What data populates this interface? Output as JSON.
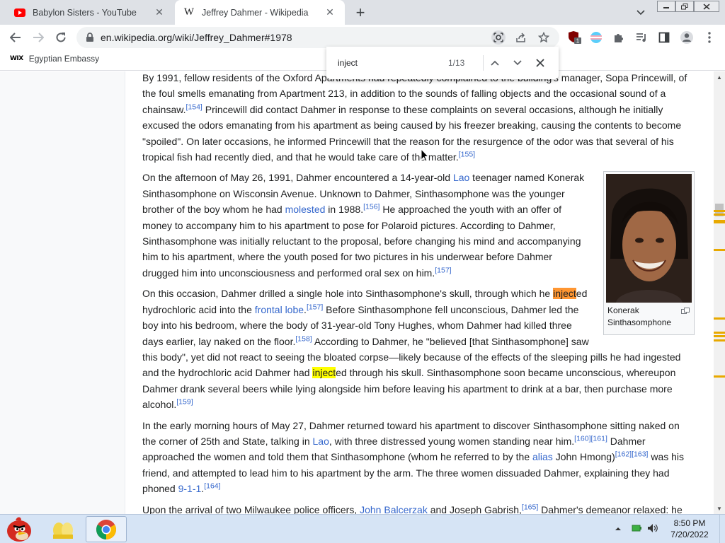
{
  "browser": {
    "tabs": [
      {
        "title": "Babylon Sisters - YouTube",
        "favicon": "youtube-icon",
        "active": false
      },
      {
        "title": "Jeffrey Dahmer - Wikipedia",
        "favicon": "wikipedia-icon",
        "active": true
      }
    ],
    "address": "en.wikipedia.org/wiki/Jeffrey_Dahmer#1978",
    "extension_badge": "1",
    "bookmarks": [
      {
        "label": "Egyptian Embassy",
        "icon_text": "WIX"
      }
    ]
  },
  "find": {
    "query": "inject",
    "count": "1/13"
  },
  "article": {
    "p1": {
      "a": "By 1991, fellow residents of the Oxford Apartments had repeatedly complained to the building's manager, Sopa Princewill, of the foul smells emanating from Apartment 213, in addition to the sounds of falling objects and the occasional sound of a chainsaw.",
      "ref1": "[154]",
      "b": " Princewill did contact Dahmer in response to these complaints on several occasions, although he initially excused the odors emanating from his apartment as being caused by his freezer breaking, causing the contents to become \"spoiled\". On later occasions, he informed Princewill that the reason for the resurgence of the odor was that several of his tropical fish had recently died, and that he would take care of the matter.",
      "ref2": "[155]"
    },
    "p2": {
      "a": "On the afternoon of May 26, 1991, Dahmer encountered a 14-year-old ",
      "link1": "Lao",
      "b": " teenager named Konerak Sinthasomphone on Wisconsin Avenue. Unknown to Dahmer, Sinthasomphone was the younger brother of the boy whom he had ",
      "link2": "molested",
      "c": " in 1988.",
      "ref1": "[156]",
      "d": " He approached the youth with an offer of money to accompany him to his apartment to pose for Polaroid pictures. According to Dahmer, Sinthasomphone was initially reluctant to the proposal, before changing his mind and accompanying him to his apartment, where the youth posed for two pictures in his underwear before Dahmer drugged him into unconsciousness and performed oral sex on him.",
      "ref2": "[157]"
    },
    "p3": {
      "a": "On this occasion, Dahmer drilled a single hole into Sinthasomphone's skull, through which he ",
      "hl1": "inject",
      "b": "ed hydrochloric acid into the ",
      "link1": "frontal lobe",
      "c": ".",
      "ref1": "[157]",
      "d": " Before Sinthasomphone fell unconscious, Dahmer led the boy into his bedroom, where the body of 31-year-old Tony Hughes, whom Dahmer had killed three days earlier, lay naked on the floor.",
      "ref2": "[158]",
      "e": " According to Dahmer, he \"believed [that Sinthasomphone] saw this body\", yet did not react to seeing the bloated corpse—likely because of the effects of the sleeping pills he had ingested and the hydrochloric acid Dahmer had ",
      "hl2": "inject",
      "f": "ed through his skull. Sinthasomphone soon became unconscious, whereupon Dahmer drank several beers while lying alongside him before leaving his apartment to drink at a bar, then purchase more alcohol.",
      "ref3": "[159]"
    },
    "p4": {
      "a": "In the early morning hours of May 27, Dahmer returned toward his apartment to discover Sinthasomphone sitting naked on the corner of 25th and State, talking in ",
      "link1": "Lao",
      "b": ", with three distressed young women standing near him.",
      "ref1": "[160]",
      "ref2": "[161]",
      "c": " Dahmer approached the women and told them that Sinthasomphone (whom he referred to by the ",
      "link2": "alias",
      "d": " John Hmong)",
      "ref3": "[162]",
      "ref4": "[163]",
      "e": " was his friend, and attempted to lead him to his apartment by the arm. The three women dissuaded Dahmer, explaining they had phoned ",
      "link3": "9-1-1",
      "f": ".",
      "ref5": "[164]"
    },
    "p5": {
      "a": "Upon the arrival of two Milwaukee police officers, ",
      "link1": "John Balcerzak",
      "b": " and Joseph Gabrish,",
      "ref1": "[165]",
      "c": " Dahmer's demeanor relaxed: he"
    },
    "figure": {
      "caption": "Konerak Sinthasomphone"
    }
  },
  "taskbar": {
    "time": "8:50 PM",
    "date": "7/20/2022"
  },
  "colors": {
    "link": "#3366cc",
    "current_match": "#ff9632",
    "other_match": "#ffff00",
    "tab_strip": "#dee1e6",
    "taskbar": "#d6e4f5"
  }
}
